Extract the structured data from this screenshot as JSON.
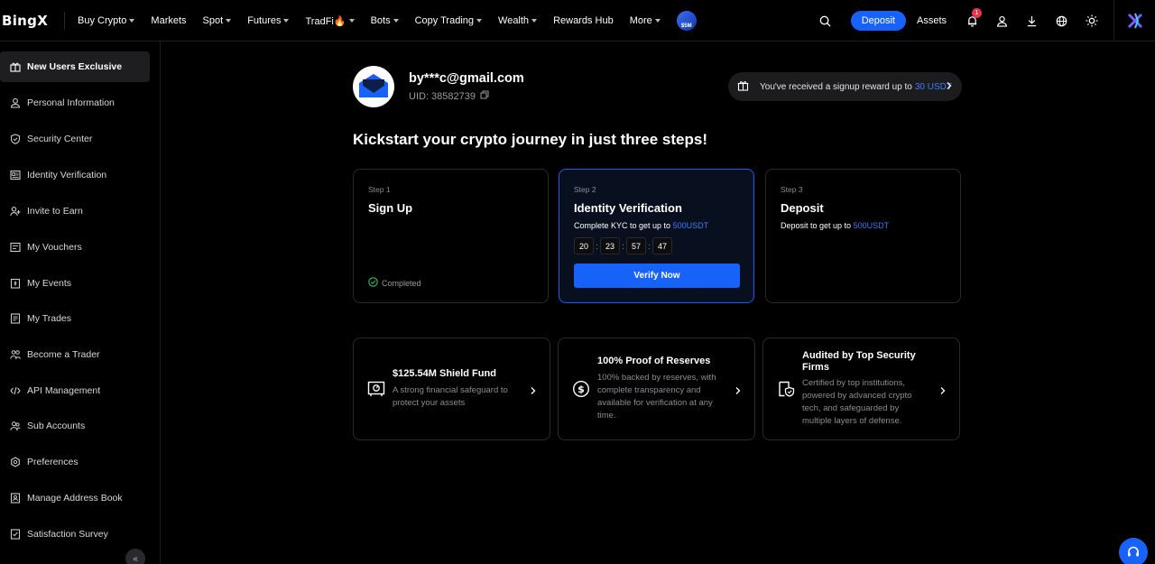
{
  "brand": {
    "logo_text": "BingX"
  },
  "nav": {
    "items": [
      {
        "label": "Buy Crypto",
        "dropdown": true
      },
      {
        "label": "Markets",
        "dropdown": false
      },
      {
        "label": "Spot",
        "dropdown": true
      },
      {
        "label": "Futures",
        "dropdown": true
      },
      {
        "label": "TradFi🔥",
        "dropdown": true
      },
      {
        "label": "Bots",
        "dropdown": true
      },
      {
        "label": "Copy Trading",
        "dropdown": true
      },
      {
        "label": "Wealth",
        "dropdown": true
      },
      {
        "label": "Rewards Hub",
        "dropdown": false
      },
      {
        "label": "More",
        "dropdown": true
      }
    ],
    "promo_badge": "$5M",
    "deposit_label": "Deposit",
    "assets_label": "Assets",
    "notification_count": "1"
  },
  "sidebar": {
    "items": [
      {
        "label": "New Users Exclusive",
        "icon": "gift-icon",
        "active": true
      },
      {
        "label": "Personal Information",
        "icon": "user-icon",
        "active": false
      },
      {
        "label": "Security Center",
        "icon": "shield-icon",
        "active": false
      },
      {
        "label": "Identity Verification",
        "icon": "id-card-icon",
        "active": false
      },
      {
        "label": "Invite to Earn",
        "icon": "user-plus-icon",
        "active": false
      },
      {
        "label": "My Vouchers",
        "icon": "voucher-icon",
        "active": false
      },
      {
        "label": "My Events",
        "icon": "event-icon",
        "active": false
      },
      {
        "label": "My Trades",
        "icon": "trades-icon",
        "active": false
      },
      {
        "label": "Become a Trader",
        "icon": "trader-icon",
        "active": false
      },
      {
        "label": "API Management",
        "icon": "code-icon",
        "active": false
      },
      {
        "label": "Sub Accounts",
        "icon": "users-icon",
        "active": false
      },
      {
        "label": "Preferences",
        "icon": "settings-icon",
        "active": false
      },
      {
        "label": "Manage Address Book",
        "icon": "address-book-icon",
        "active": false
      },
      {
        "label": "Satisfaction Survey",
        "icon": "survey-icon",
        "active": false
      }
    ],
    "collapse_label": "«"
  },
  "profile": {
    "email": "by***c@gmail.com",
    "uid": "UID: 38582739"
  },
  "reward": {
    "text": "You've received a signup reward up to",
    "amount": "30 USDT"
  },
  "headline": "Kickstart your crypto journey in just three steps!",
  "steps": [
    {
      "label": "Step 1",
      "title": "Sign Up",
      "status": "Completed"
    },
    {
      "label": "Step 2",
      "title": "Identity Verification",
      "desc": "Complete KYC to get up to",
      "amount": "500USDT",
      "countdown": [
        "20",
        "23",
        "57",
        "47"
      ],
      "button": "Verify Now"
    },
    {
      "label": "Step 3",
      "title": "Deposit",
      "desc": "Deposit to get up to",
      "amount": "500USDT"
    }
  ],
  "features": [
    {
      "title": "$125.54M Shield Fund",
      "desc": "A strong financial safeguard to protect your assets",
      "icon": "shield-fund-icon"
    },
    {
      "title": "100% Proof of Reserves",
      "desc": "100% backed by reserves, with complete transparency and available for verification at any time.",
      "icon": "dollar-coin-icon"
    },
    {
      "title": "Audited by Top Security Firms",
      "desc": "Certified by top institutions, powered by advanced crypto tech, and safeguarded by multiple layers of defense.",
      "icon": "audit-shield-icon"
    }
  ],
  "colors": {
    "accent": "#1762f8",
    "highlight": "#3a7bff",
    "badge": "#e8334a"
  }
}
